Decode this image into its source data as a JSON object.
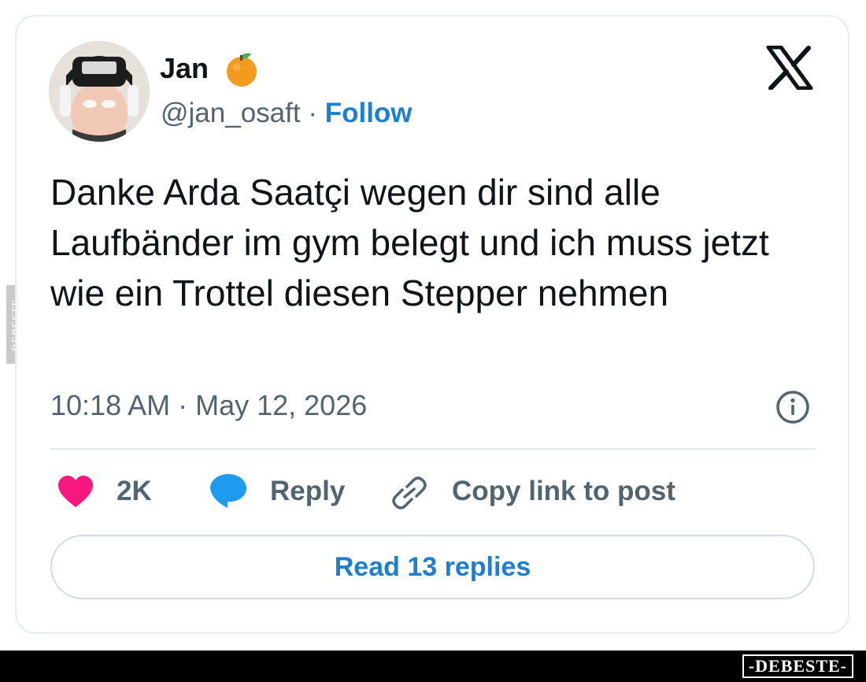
{
  "watermark": {
    "side_text": "DEBESTE",
    "footer_text": "-DEBESTE-"
  },
  "user": {
    "display_name": "Jan",
    "handle": "@jan_osaft",
    "separator": "·",
    "follow_label": "Follow",
    "badge_icon": "orange-emoji-icon",
    "avatar_icon": "avatar-photo"
  },
  "platform_icon": "x-logo-icon",
  "tweet": {
    "text": "Danke Arda Saatçi wegen dir sind alle Laufbänder im gym belegt und ich muss jetzt wie ein Trottel diesen Stepper nehmen",
    "timestamp": "10:18 AM · May 12, 2026"
  },
  "actions": {
    "like_count": "2K",
    "reply_label": "Reply",
    "copy_link_label": "Copy link to post"
  },
  "read_replies_label": "Read 13 replies",
  "colors": {
    "accent": "#1d7fd1",
    "heart": "#f91880",
    "bubble": "#1d9bf0",
    "text": "#0f1419",
    "muted": "#536471"
  }
}
